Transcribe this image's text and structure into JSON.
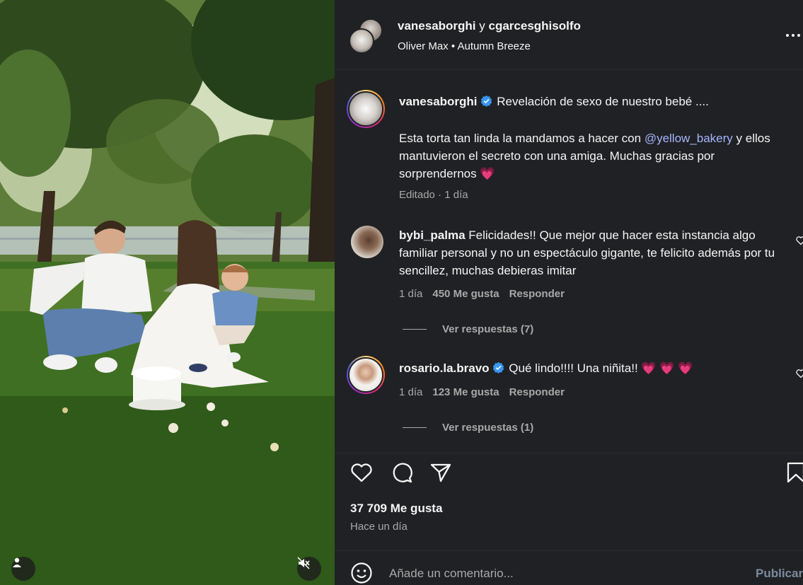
{
  "media": {
    "user_icon": "user-tag-icon",
    "mute_icon": "speaker-muted-icon"
  },
  "header": {
    "author": "vanesaborghi",
    "joiner": "y",
    "collaborator": "cgarcesghisolfo",
    "audio_artist": "Oliver Max",
    "audio_sep": "•",
    "audio_track": "Autumn Breeze",
    "more_icon": "more-options-icon"
  },
  "caption": {
    "username": "vanesaborghi",
    "verified": true,
    "title": "Revelación de sexo de nuestro bebé ....",
    "body_pre": "Esta torta tan linda la mandamos a hacer con ",
    "mention": "@yellow_bakery",
    "body_post": " y ellos mantuvieron el secreto con una amiga. Muchas gracias por sorprendernos",
    "emoji": "💗",
    "meta_edited": "Editado",
    "meta_dot": "·",
    "meta_time": "1 día"
  },
  "comments": [
    {
      "username": "bybi_palma",
      "verified": false,
      "text": "Felicidades!! Que mejor que hacer esta instancia algo familiar personal y no un espectáculo gigante, te felicito además por tu sencillez, muchas debieras imitar",
      "time": "1 día",
      "likes": "450 Me gusta",
      "reply": "Responder",
      "view_replies": "Ver respuestas (7)"
    },
    {
      "username": "rosario.la.bravo",
      "verified": true,
      "text": "Qué lindo!!!! Una niñita!!",
      "emoji": "💗 💗 💗",
      "time": "1 día",
      "likes": "123 Me gusta",
      "reply": "Responder",
      "view_replies": "Ver respuestas (1)"
    }
  ],
  "actions": {
    "like_icon": "heart-icon",
    "comment_icon": "comment-icon",
    "share_icon": "share-icon",
    "save_icon": "bookmark-icon"
  },
  "stats": {
    "likes": "37 709 Me gusta",
    "posted": "Hace un día"
  },
  "composer": {
    "emoji_icon": "emoji-icon",
    "placeholder": "Añade un comentario...",
    "value": "",
    "publish": "Publicar"
  },
  "colors": {
    "panel_bg": "#202124",
    "text": "#f5f5f5",
    "secondary": "#a8a8a8",
    "mention": "#a5b4fc",
    "verified": "#3897f0",
    "heart": "#ff3f73",
    "publish_disabled": "#7b8a9e"
  }
}
